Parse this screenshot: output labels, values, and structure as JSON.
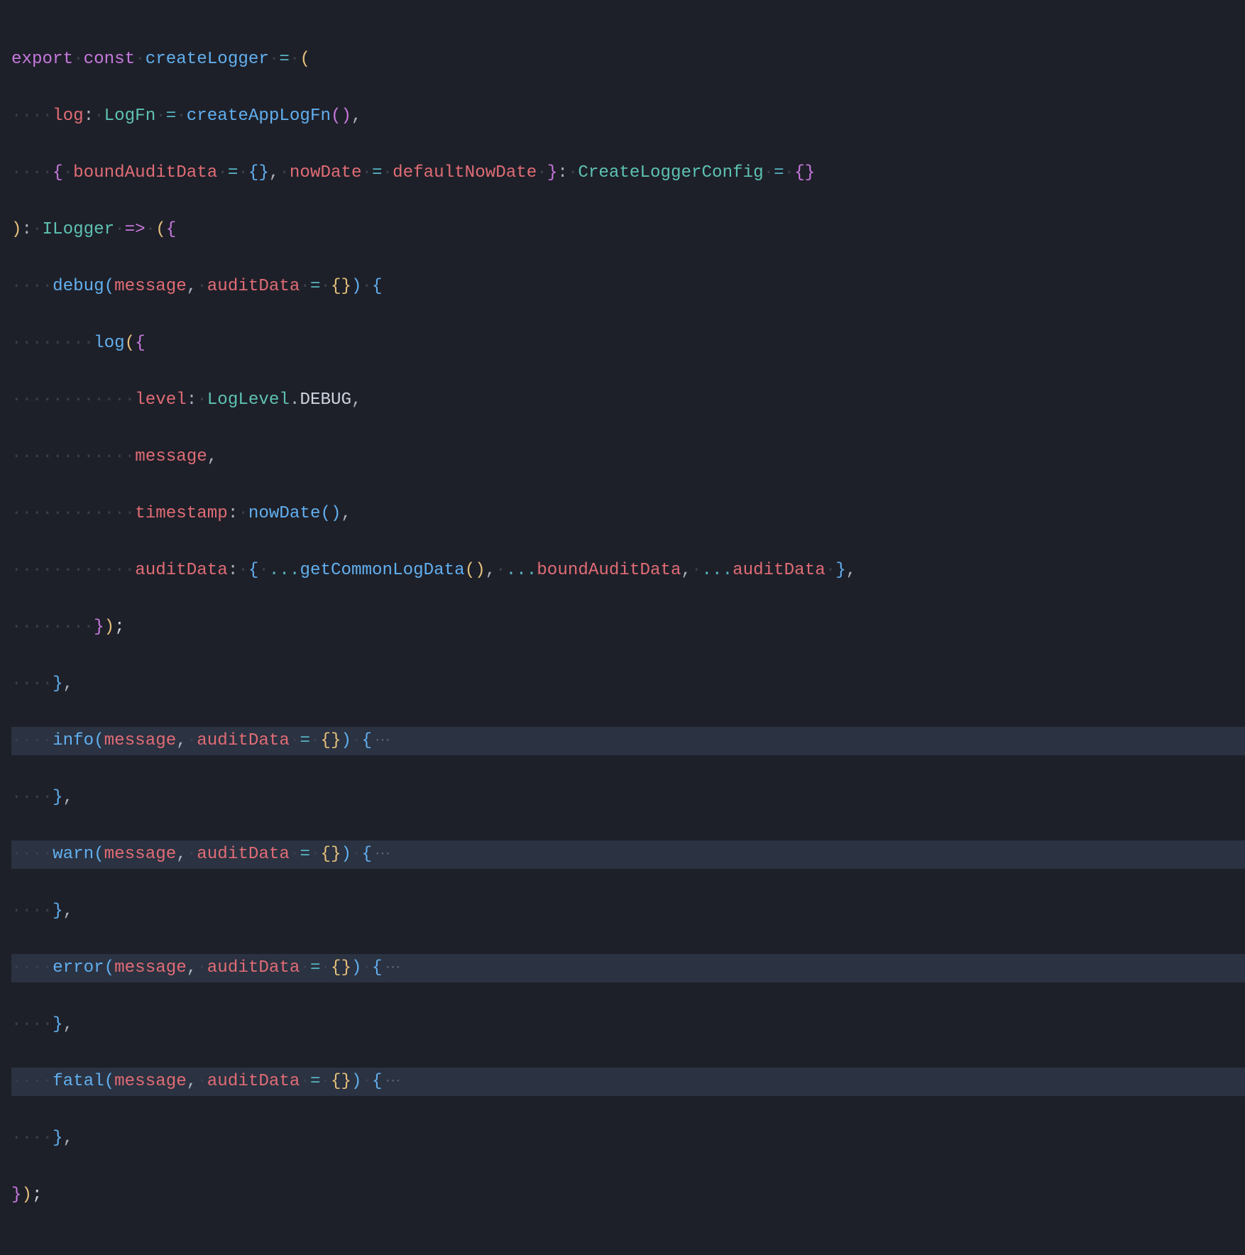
{
  "tokens": {
    "export": "export",
    "const": "const",
    "createLogger": "createLogger",
    "log": "log",
    "LogFn": "LogFn",
    "createAppLogFn": "createAppLogFn",
    "boundAuditData": "boundAuditData",
    "nowDate": "nowDate",
    "defaultNowDate": "defaultNowDate",
    "CreateLoggerConfig": "CreateLoggerConfig",
    "ILogger": "ILogger",
    "debug": "debug",
    "message": "message",
    "auditData": "auditData",
    "level": "level",
    "LogLevel": "LogLevel",
    "DEBUG": "DEBUG",
    "timestamp": "timestamp",
    "getCommonLogData": "getCommonLogData",
    "info": "info",
    "warn": "warn",
    "error": "error",
    "fatal": "fatal"
  },
  "ws": {
    "dot4": "····",
    "dot8": "········",
    "dot12": "············",
    "dot1s": "·"
  },
  "fold": "⋯"
}
